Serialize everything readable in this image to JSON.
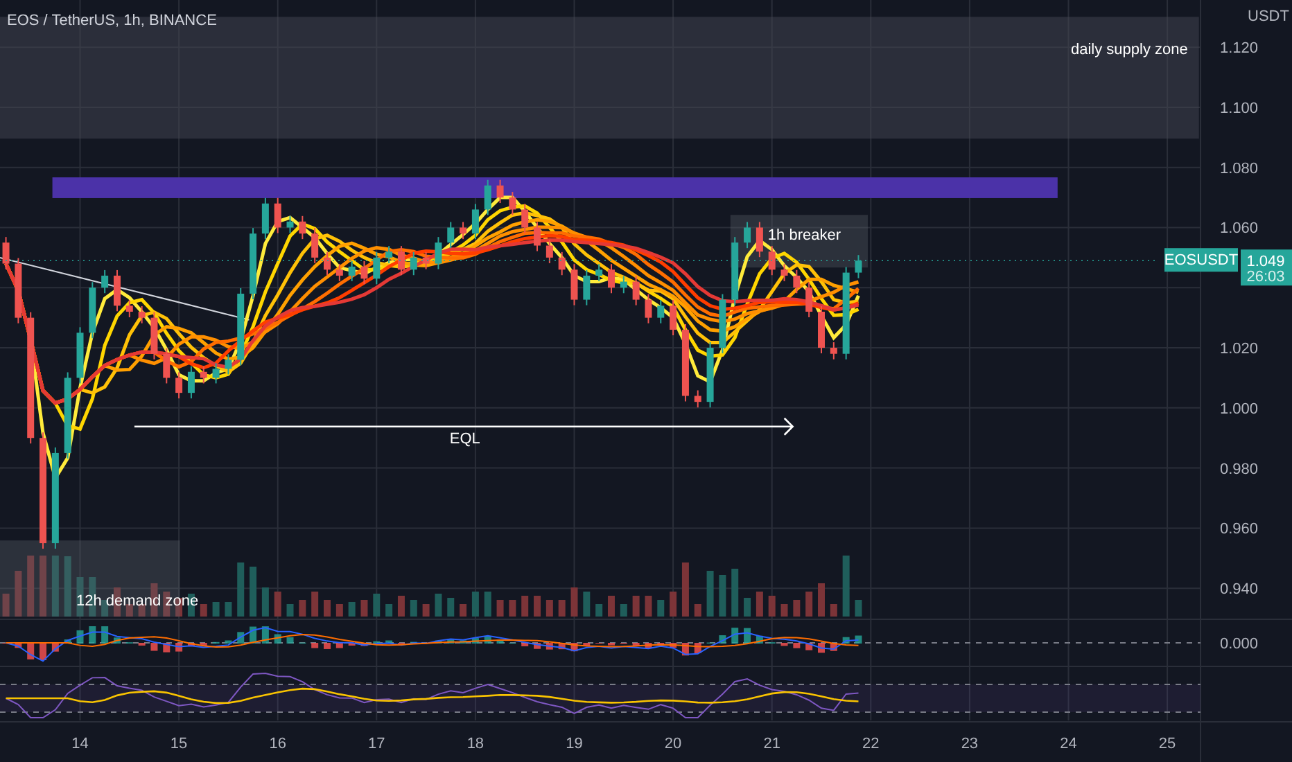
{
  "chart": {
    "title": "EOS / TetherUS, 1h, BINANCE",
    "axis_unit": "USDT",
    "price_labels": [
      "1.120",
      "1.100",
      "1.080",
      "1.060",
      "1.020",
      "1.000",
      "0.980",
      "0.960",
      "0.940"
    ],
    "date_labels": [
      "14",
      "15",
      "16",
      "17",
      "18",
      "19",
      "20",
      "21",
      "22",
      "23",
      "24",
      "25"
    ],
    "annotations": [
      {
        "kind": "zone",
        "text": "daily supply zone"
      },
      {
        "kind": "band"
      },
      {
        "kind": "box",
        "text": "1h breaker"
      },
      {
        "kind": "box",
        "text": "12h demand zone"
      },
      {
        "kind": "trendline"
      },
      {
        "kind": "arrow",
        "text": "EQL"
      }
    ],
    "symbol_tag": "EOSUSDT",
    "last_price": "1.049",
    "countdown": "26:03",
    "macd_zero_label": "0.000"
  }
}
